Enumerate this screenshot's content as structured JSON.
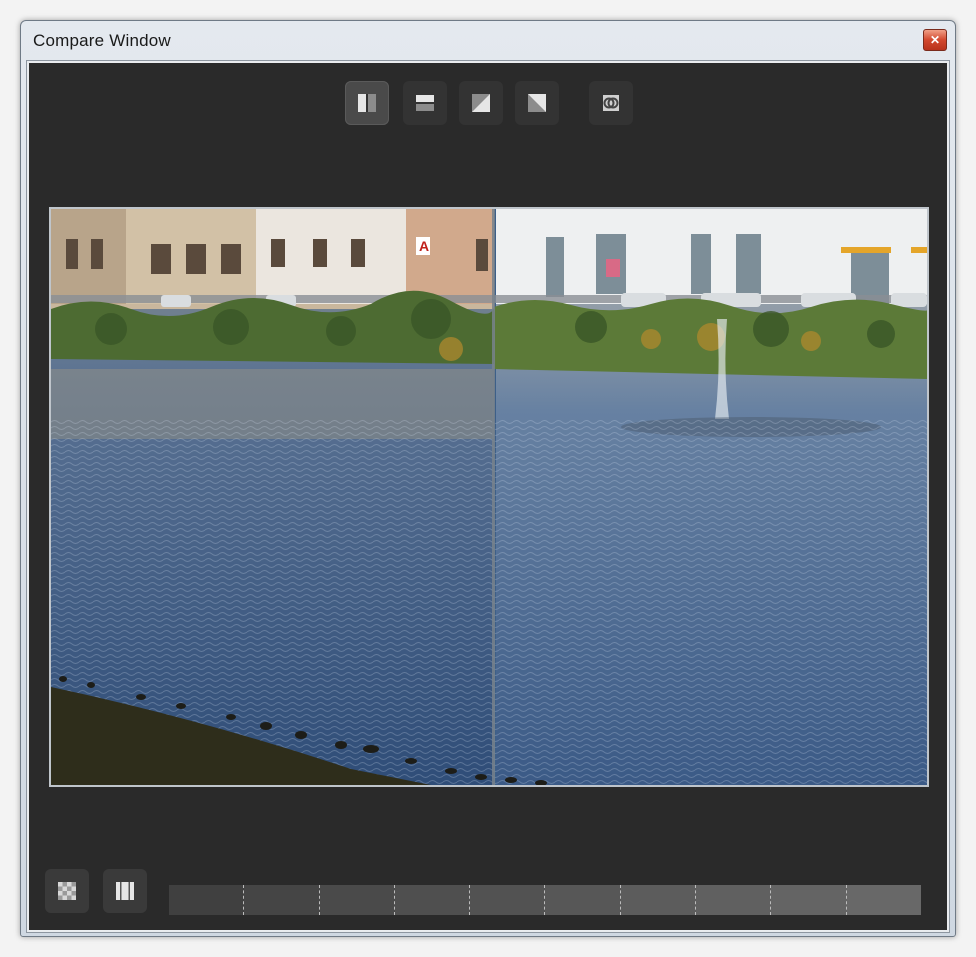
{
  "window": {
    "title": "Compare Window"
  },
  "toolbar": {
    "buttons": [
      {
        "icon": "split-vertical-icon",
        "active": true
      },
      {
        "icon": "split-horizontal-icon",
        "active": false
      },
      {
        "icon": "split-diagonal-icon",
        "active": false
      },
      {
        "icon": "split-antidiagonal-icon",
        "active": false
      },
      {
        "icon": "link-views-icon",
        "active": false
      }
    ]
  },
  "viewer": {
    "split_position": 0.505
  },
  "bottom": {
    "buttons": [
      {
        "icon": "checker-pattern-icon"
      },
      {
        "icon": "split-view-toggle-icon"
      }
    ],
    "timeline_segments": [
      "#404040",
      "#454545",
      "#4a4a4a",
      "#4f4f4f",
      "#525252",
      "#575757",
      "#5c5c5c",
      "#606060",
      "#646464",
      "#686868"
    ]
  }
}
